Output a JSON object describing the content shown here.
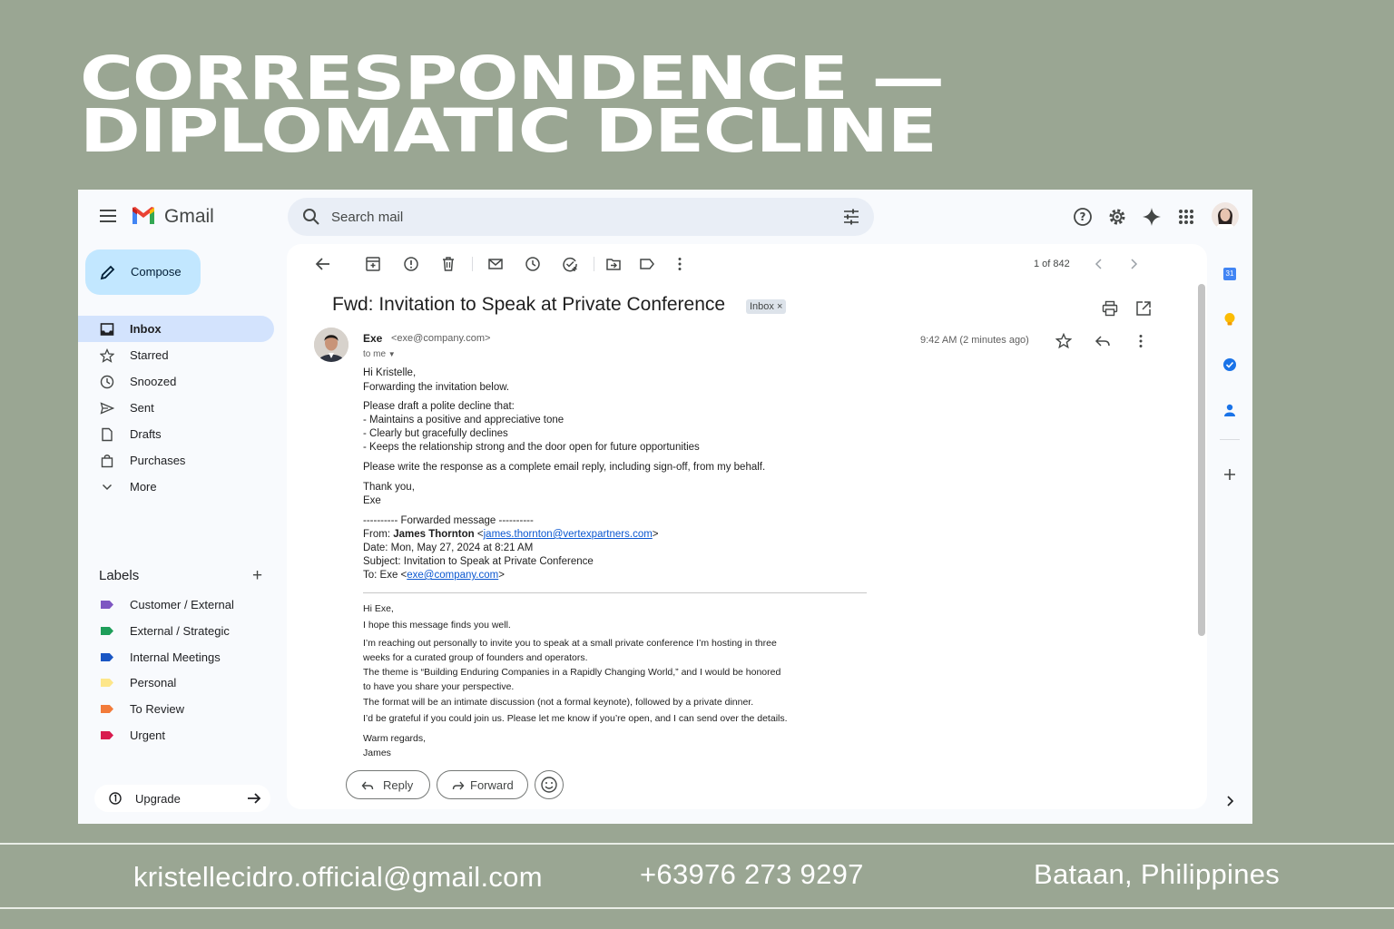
{
  "poster": {
    "title_line1": "CORRESPONDENCE —",
    "title_line2": "DIPLOMATIC DECLINE",
    "footer_email": "kristellecidro.official@gmail.com",
    "footer_phone": "+63976 273 9297",
    "footer_location": "Bataan, Philippines"
  },
  "app": {
    "name": "Gmail",
    "search_placeholder": "Search mail"
  },
  "sidebar": {
    "compose_label": "Compose",
    "items": [
      {
        "label": "Inbox",
        "icon": "inbox-icon",
        "active": true
      },
      {
        "label": "Starred",
        "icon": "star-icon"
      },
      {
        "label": "Snoozed",
        "icon": "clock-icon"
      },
      {
        "label": "Sent",
        "icon": "send-icon"
      },
      {
        "label": "Drafts",
        "icon": "draft-icon"
      },
      {
        "label": "Purchases",
        "icon": "shopping-bag-icon"
      },
      {
        "label": "More",
        "icon": "chevron-down-icon"
      }
    ],
    "labels_heading": "Labels",
    "labels": [
      {
        "label": "Customer / External",
        "color": "#7e57c2"
      },
      {
        "label": "External / Strategic",
        "color": "#1e9e5a"
      },
      {
        "label": "Internal Meetings",
        "color": "#1a56c4"
      },
      {
        "label": "Personal",
        "color": "#fde68a"
      },
      {
        "label": "To Review",
        "color": "#f27b3a"
      },
      {
        "label": "Urgent",
        "color": "#d81b4e"
      }
    ],
    "upgrade_label": "Upgrade"
  },
  "toolbar": {
    "pager": "1 of 842"
  },
  "email": {
    "subject": "Fwd: Invitation to Speak at Private Conference",
    "chip": "Inbox ×",
    "sender_name": "Exe",
    "sender_email": "<exe@company.com>",
    "to": "to me",
    "time": "9:42 AM (2 minutes ago)",
    "greeting": "Hi Kristelle,",
    "line1": "Forwarding the invitation below.",
    "instr_intro": "Please draft a polite decline that:",
    "instr_1": "- Maintains a positive and appreciative tone",
    "instr_2": "- Clearly but gracefully declines",
    "instr_3": "- Keeps the relationship strong and the door open for future opportunities",
    "instr_final": "Please write the response as a complete email reply, including sign-off, from my behalf.",
    "thanks": "Thank you,",
    "signoff": "Exe",
    "fwd_header": "---------- Forwarded message ----------",
    "fwd_from_label": "From: ",
    "fwd_from_name": "James Thornton",
    "fwd_from_email": "james.thornton@vertexpartners.com",
    "fwd_date": "Date: Mon, May 27, 2024 at 8:21 AM",
    "fwd_subject": "Subject: Invitation to Speak at Private Conference",
    "fwd_to_label": "To: Exe <",
    "fwd_to_email": "exe@company.com",
    "inner_greeting": "Hi Exe,",
    "inner_1": "I hope this message finds you well.",
    "inner_2": "I’m reaching out personally to invite you to speak at a small private conference I’m hosting in three",
    "inner_3": "weeks for a curated group of founders and operators.",
    "inner_4": "The theme is “Building Enduring Companies in a Rapidly Changing World,” and I would be honored",
    "inner_5": "to have you share your perspective.",
    "inner_6": "The format will be an intimate discussion (not a formal keynote), followed by a private dinner.",
    "inner_7": "I’d be grateful if you could join us. Please let me know if you’re open, and I can send over the details.",
    "inner_regards": "Warm regards,",
    "inner_name": "James"
  },
  "actions": {
    "reply": "Reply",
    "forward": "Forward"
  },
  "rightbar": {
    "calendar_day": "31"
  }
}
